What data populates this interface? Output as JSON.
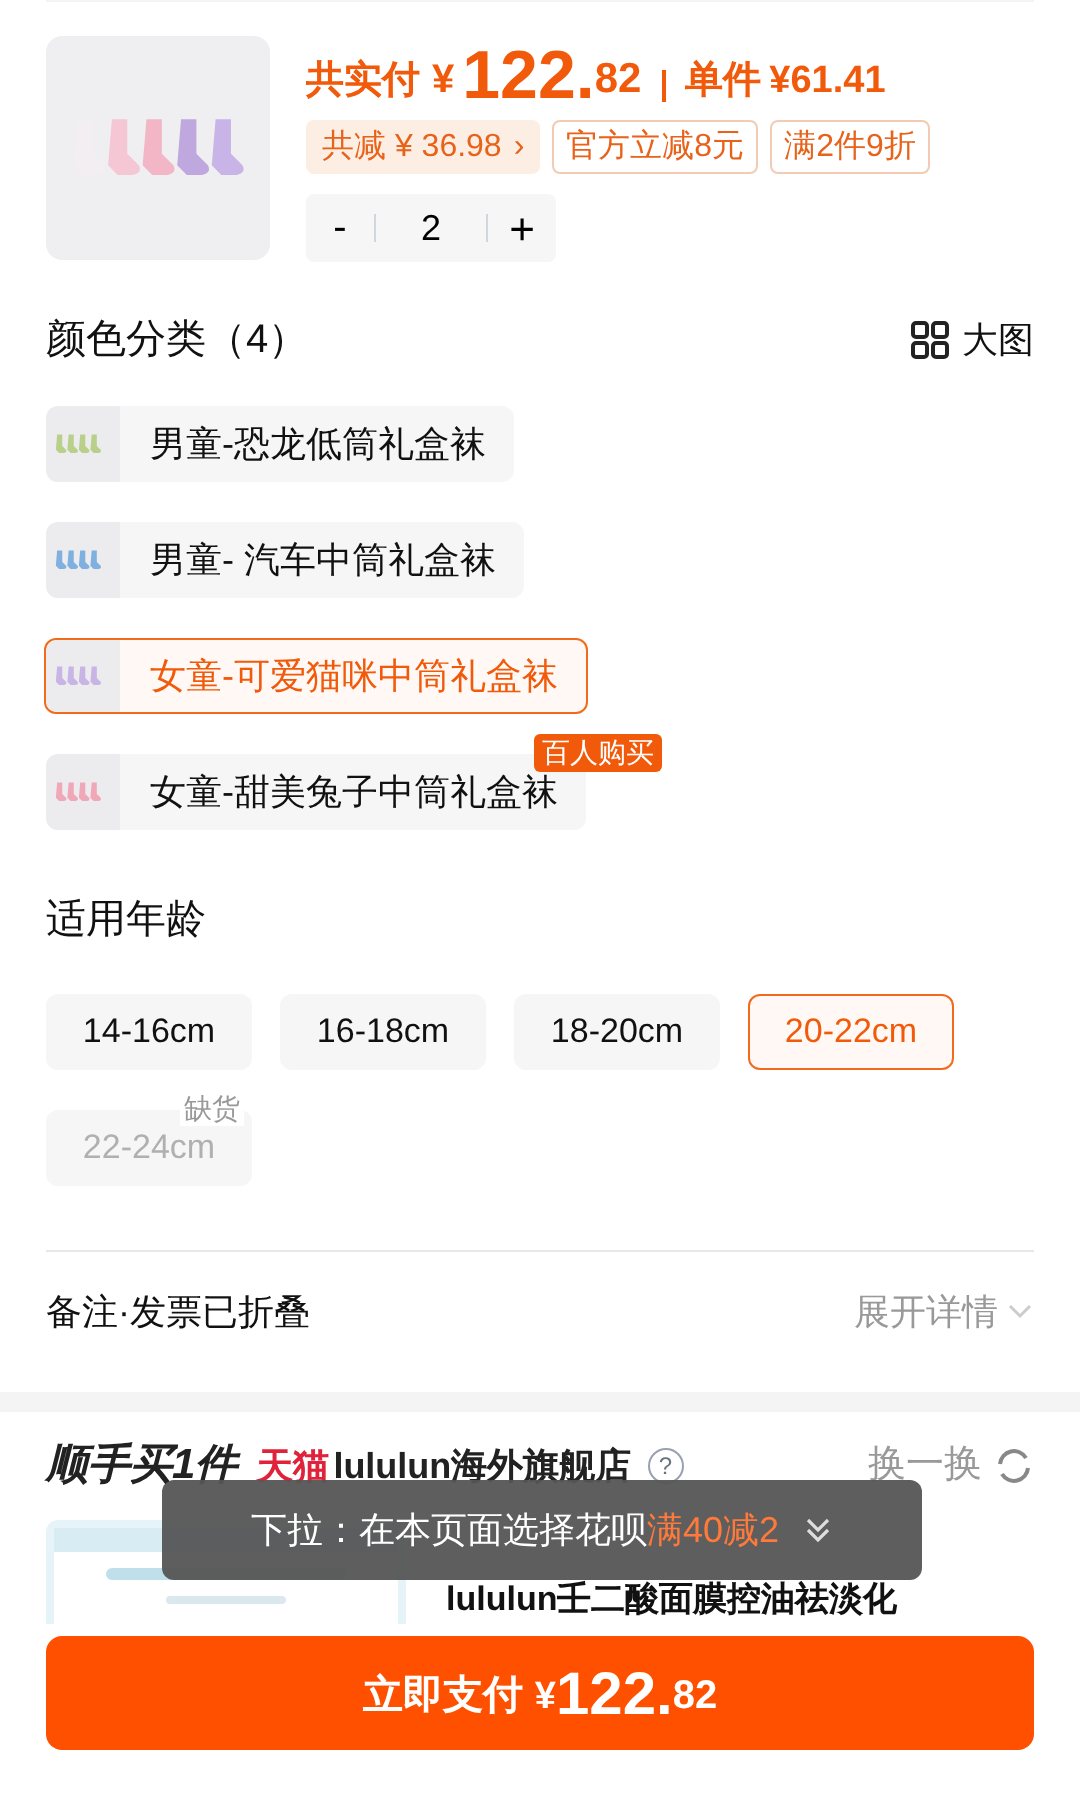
{
  "product": {
    "total_label": "共实付",
    "currency": "¥",
    "total_int": "122.",
    "total_dec": "82",
    "unit_label": "单件",
    "unit_price": "¥61.41",
    "discount": "共减 ¥ 36.98",
    "discount_arrow": "›",
    "tags": [
      "官方立减8元",
      "满2件9折"
    ],
    "quantity": {
      "minus": "-",
      "value": "2",
      "plus": "+"
    }
  },
  "colors": {
    "title": "颜色分类（4）",
    "view_label": "大图",
    "items": [
      {
        "label": "男童-恐龙低筒礼盒袜",
        "selected": false,
        "color": "#b9d08a"
      },
      {
        "label": "男童- 汽车中筒礼盒袜",
        "selected": false,
        "color": "#7fb0e0"
      },
      {
        "label": "女童-可爱猫咪中筒礼盒袜",
        "selected": true,
        "color": "#c9b4e6"
      },
      {
        "label": "女童-甜美兔子中筒礼盒袜",
        "selected": false,
        "color": "#f0a8b8",
        "badge": "百人购买"
      }
    ]
  },
  "sizes": {
    "title": "适用年龄",
    "items": [
      {
        "label": "14-16cm",
        "selected": false,
        "disabled": false
      },
      {
        "label": "16-18cm",
        "selected": false,
        "disabled": false
      },
      {
        "label": "18-20cm",
        "selected": false,
        "disabled": false
      },
      {
        "label": "20-22cm",
        "selected": true,
        "disabled": false
      },
      {
        "label": "22-24cm",
        "selected": false,
        "disabled": true,
        "note": "缺货"
      }
    ]
  },
  "notes": {
    "label": "备注·发票已折叠",
    "action": "展开详情"
  },
  "addon": {
    "title": "顺手买1件",
    "store_prefix": "天猫",
    "store": "lululun海外旗舰店",
    "help": "?",
    "swap": "换一换",
    "product_name": "lululun壬二酸面膜控油祛淡化"
  },
  "toast": {
    "text": "下拉：在本页面选择花呗",
    "highlight": "满40减2"
  },
  "pay_button": {
    "label": "立即支付",
    "currency": "¥",
    "int": "122.",
    "dec": "82"
  }
}
